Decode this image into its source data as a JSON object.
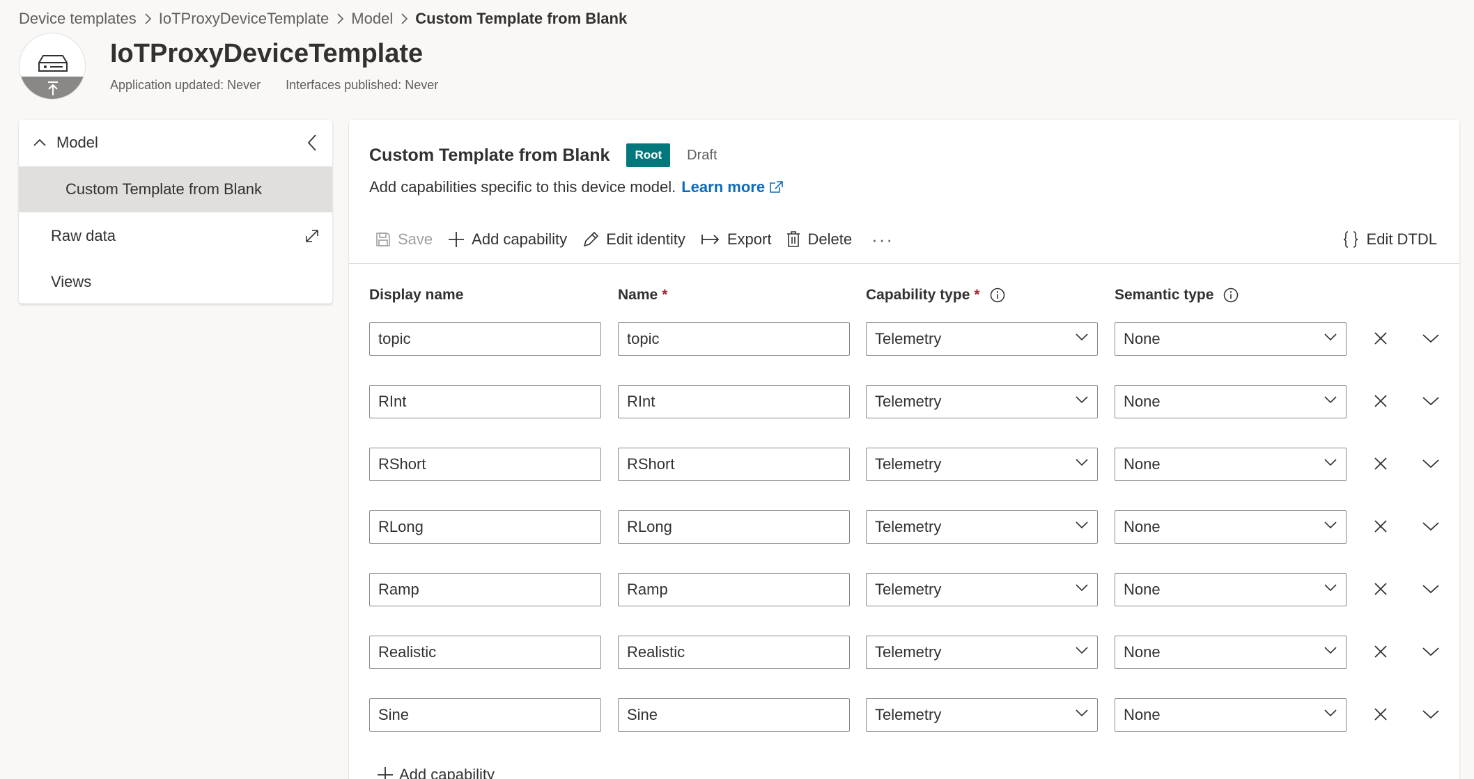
{
  "breadcrumb": {
    "items": [
      "Device templates",
      "IoTProxyDeviceTemplate",
      "Model"
    ],
    "current": "Custom Template from Blank"
  },
  "header": {
    "title": "IoTProxyDeviceTemplate",
    "app_updated": "Application updated: Never",
    "interfaces_published": "Interfaces published: Never"
  },
  "nav": {
    "model_label": "Model",
    "items": [
      {
        "label": "Custom Template from Blank",
        "selected": true
      },
      {
        "label": "Raw data"
      },
      {
        "label": "Views"
      }
    ]
  },
  "panel": {
    "title": "Custom Template from Blank",
    "badge": "Root",
    "status": "Draft",
    "description": "Add capabilities specific to this device model.",
    "learn_more": "Learn more"
  },
  "toolbar": {
    "save": "Save",
    "add_capability": "Add capability",
    "edit_identity": "Edit identity",
    "export": "Export",
    "delete": "Delete",
    "more": "···",
    "edit_dtdl": "Edit DTDL"
  },
  "columns": {
    "display_name": "Display name",
    "name": "Name",
    "capability_type": "Capability type",
    "semantic_type": "Semantic type",
    "required_mark": "*"
  },
  "rows": [
    {
      "display_name": "topic",
      "name": "topic",
      "capability_type": "Telemetry",
      "semantic_type": "None"
    },
    {
      "display_name": "RInt",
      "name": "RInt",
      "capability_type": "Telemetry",
      "semantic_type": "None"
    },
    {
      "display_name": "RShort",
      "name": "RShort",
      "capability_type": "Telemetry",
      "semantic_type": "None"
    },
    {
      "display_name": "RLong",
      "name": "RLong",
      "capability_type": "Telemetry",
      "semantic_type": "None"
    },
    {
      "display_name": "Ramp",
      "name": "Ramp",
      "capability_type": "Telemetry",
      "semantic_type": "None"
    },
    {
      "display_name": "Realistic",
      "name": "Realistic",
      "capability_type": "Telemetry",
      "semantic_type": "None"
    },
    {
      "display_name": "Sine",
      "name": "Sine",
      "capability_type": "Telemetry",
      "semantic_type": "None"
    }
  ],
  "add_capability_bottom": "Add capability",
  "colors": {
    "accent_teal": "#03787c",
    "link_blue": "#0f6cbd",
    "required_red": "#a4262c",
    "selected_nav_bg": "#e1dfdd"
  }
}
